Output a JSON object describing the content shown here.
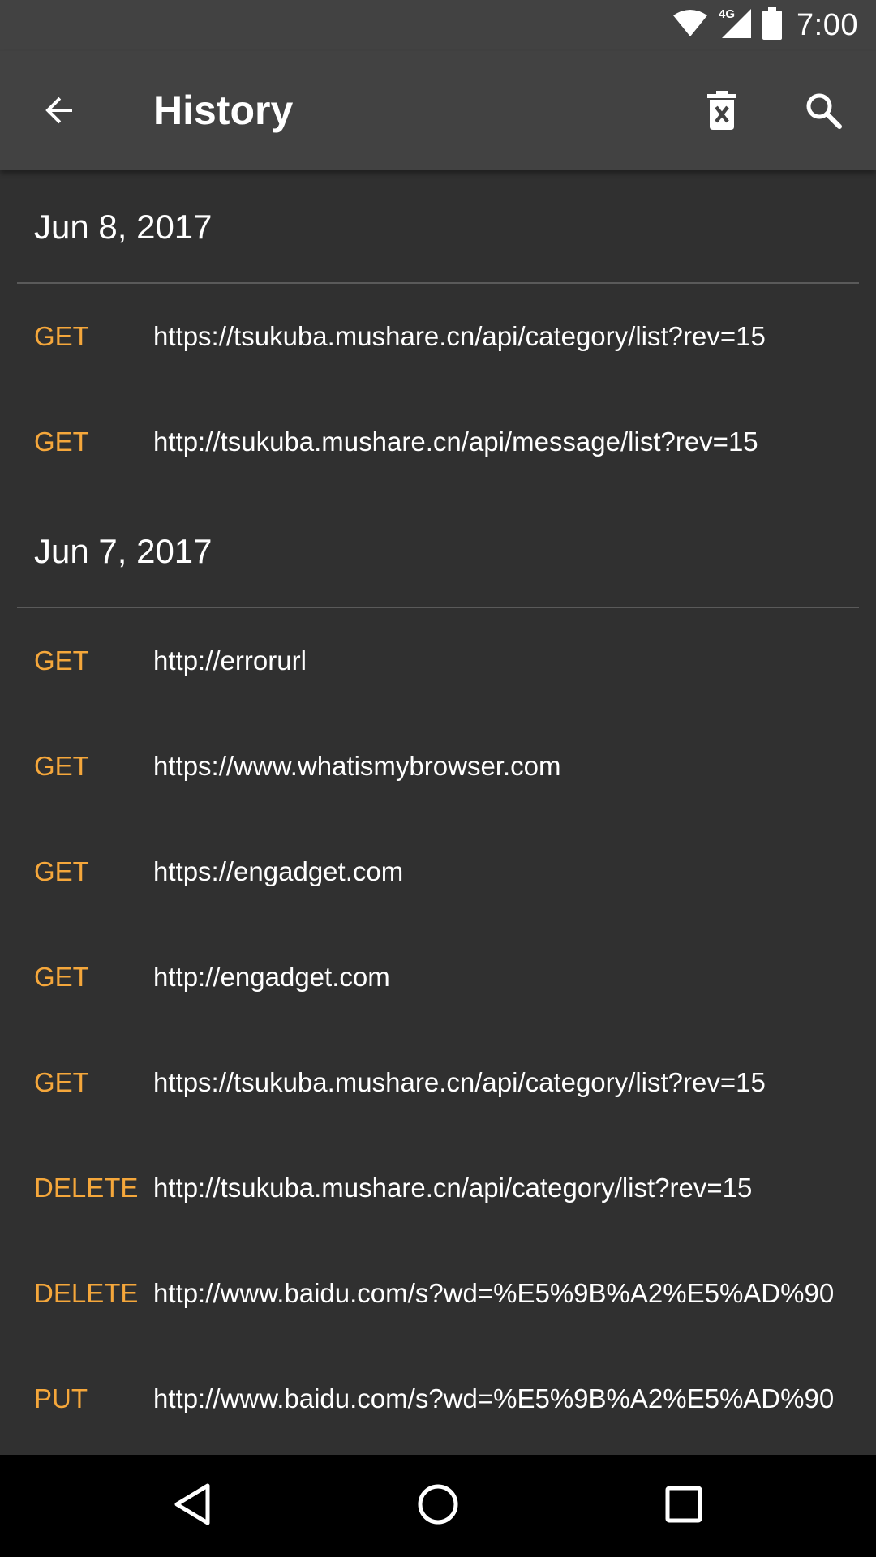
{
  "status_bar": {
    "time": "7:00",
    "network": "4G",
    "icons": [
      "wifi-icon",
      "cell-signal-icon",
      "battery-icon"
    ]
  },
  "app_bar": {
    "title": "History",
    "icons": {
      "back": "arrow-back-icon",
      "clear": "delete-forever-icon",
      "search": "search-icon"
    }
  },
  "colors": {
    "background": "#303030",
    "app_bar": "#424242",
    "method": "#f5a73b",
    "text": "#ffffff",
    "divider": "#5a5a5a",
    "nav_bar": "#000000"
  },
  "sections": [
    {
      "date": "Jun 8, 2017",
      "items": [
        {
          "method": "GET",
          "url": "https://tsukuba.mushare.cn/api/category/list?rev=15"
        },
        {
          "method": "GET",
          "url": "http://tsukuba.mushare.cn/api/message/list?rev=15"
        }
      ]
    },
    {
      "date": "Jun 7, 2017",
      "items": [
        {
          "method": "GET",
          "url": "http://errorurl"
        },
        {
          "method": "GET",
          "url": "https://www.whatismybrowser.com"
        },
        {
          "method": "GET",
          "url": "https://engadget.com"
        },
        {
          "method": "GET",
          "url": "http://engadget.com"
        },
        {
          "method": "GET",
          "url": "https://tsukuba.mushare.cn/api/category/list?rev=15"
        },
        {
          "method": "DELETE",
          "url": "http://tsukuba.mushare.cn/api/category/list?rev=15"
        },
        {
          "method": "DELETE",
          "url": "http://www.baidu.com/s?wd=%E5%9B%A2%E5%AD%90"
        },
        {
          "method": "PUT",
          "url": "http://www.baidu.com/s?wd=%E5%9B%A2%E5%AD%90"
        }
      ]
    }
  ],
  "nav_bar": {
    "icons": [
      "nav-back-icon",
      "nav-home-icon",
      "nav-recents-icon"
    ]
  }
}
